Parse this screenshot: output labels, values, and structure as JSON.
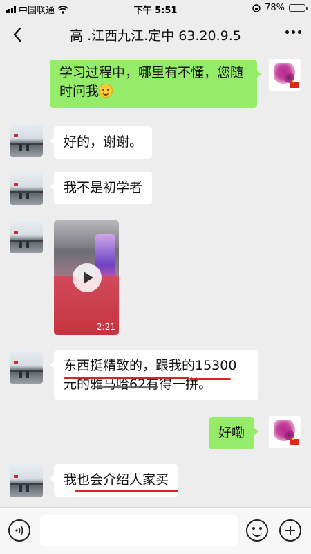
{
  "status_bar": {
    "carrier": "中国联通",
    "time": "下午 5:51",
    "battery": "78%",
    "battery_level": 0.78
  },
  "header": {
    "title": "高 .江西九江.定中 63.20.9.5"
  },
  "messages": [
    {
      "side": "right",
      "type": "text",
      "text": "学习过程中，哪里有不懂，您随时问我"
    },
    {
      "side": "left",
      "type": "text",
      "text": "好的，谢谢。"
    },
    {
      "side": "left",
      "type": "text",
      "text": "我不是初学者"
    },
    {
      "side": "left",
      "type": "video",
      "duration": "2:21"
    },
    {
      "side": "left",
      "type": "text",
      "text_line1": "东西挺精致的，跟我的15300",
      "text_line2": "元的雅马哈62有得一拼。"
    },
    {
      "side": "right",
      "type": "text",
      "text": "好嘞"
    },
    {
      "side": "left",
      "type": "text",
      "text": "我也会介绍人家买"
    }
  ],
  "input_bar": {
    "placeholder": ""
  },
  "icons": {
    "back": "chevron-left-icon",
    "more": "more-dots-icon",
    "voice": "voice-icon",
    "emoji": "emoji-icon",
    "plus": "plus-icon",
    "play": "play-icon"
  },
  "colors": {
    "background": "#ededed",
    "sent_bubble": "#95ec69",
    "received_bubble": "#ffffff",
    "underline": "#d9251d"
  }
}
